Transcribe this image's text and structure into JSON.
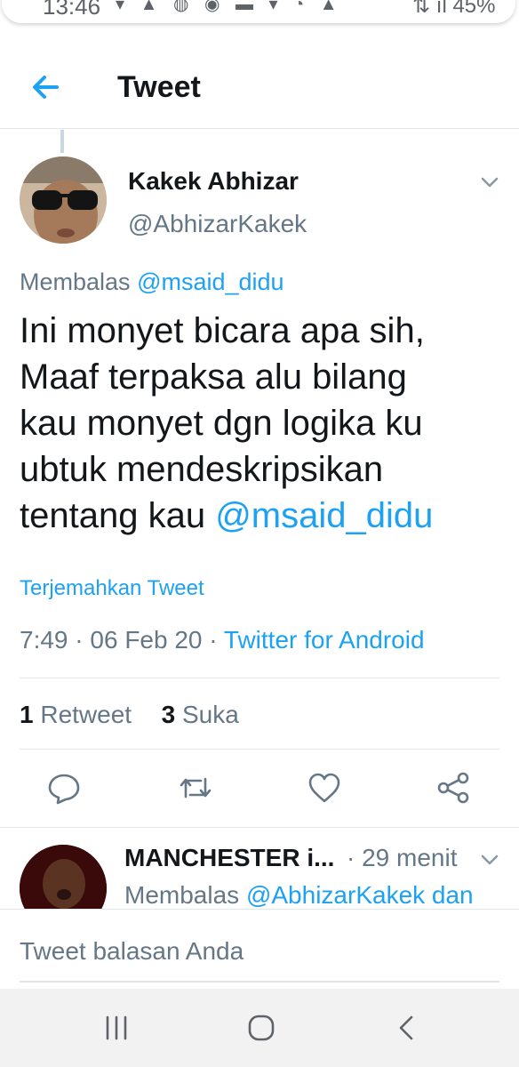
{
  "status_bar": {
    "time": "13:46",
    "battery": "45%"
  },
  "header": {
    "title": "Tweet"
  },
  "tweet": {
    "author_name": "Kakek Abhizar",
    "author_handle": "@AbhizarKakek",
    "reply_prefix": "Membalas",
    "reply_mention": "@msaid_didu",
    "text": "Ini monyet bicara apa sih,\nMaaf terpaksa alu bilang\nkau monyet dgn logika ku\nubtuk mendeskripsikan\ntentang kau ",
    "text_mention": "@msaid_didu",
    "translate_label": "Terjemahkan Tweet",
    "time": "7:49",
    "date": "06 Feb 20",
    "source": "Twitter for Android",
    "retweet_count": "1",
    "retweet_label": "Retweet",
    "like_count": "3",
    "like_label": "Suka"
  },
  "reply": {
    "author_name": "MANCHESTER i...",
    "time": "· 29 menit",
    "prefix": "Membalas",
    "mentions": "@AbhizarKakek dan"
  },
  "composer": {
    "placeholder": "Tweet balasan Anda"
  },
  "colors": {
    "accent": "#1da1f2",
    "text": "#14171a",
    "secondary": "#657786",
    "divider": "#e1e8ed"
  },
  "icons": [
    "back-arrow-icon",
    "chevron-down-icon",
    "reply-icon",
    "retweet-icon",
    "like-icon",
    "share-icon",
    "recent-apps-icon",
    "home-icon",
    "nav-back-icon"
  ]
}
